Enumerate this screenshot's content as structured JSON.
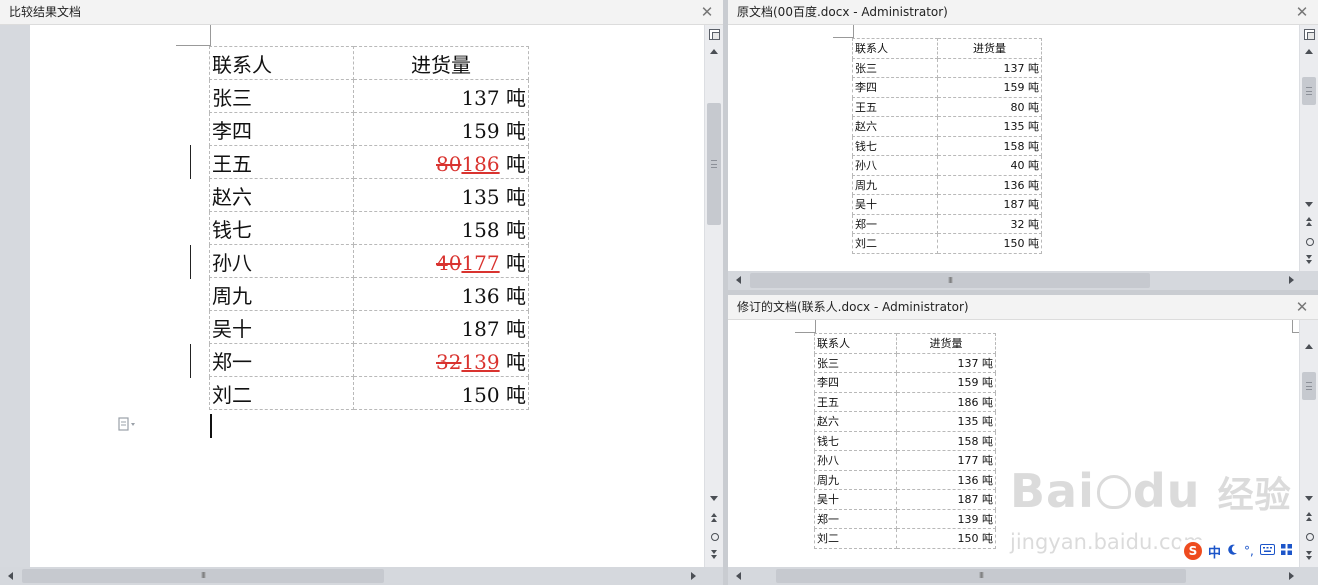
{
  "left_pane": {
    "title": "比较结果文档",
    "close": "✕",
    "header": [
      "联系人",
      "进货量"
    ],
    "unit": "吨",
    "rows": [
      {
        "name": "张三",
        "value": "137"
      },
      {
        "name": "李四",
        "value": "159"
      },
      {
        "name": "王五",
        "deleted": "80",
        "inserted": "186"
      },
      {
        "name": "赵六",
        "value": "135"
      },
      {
        "name": "钱七",
        "value": "158"
      },
      {
        "name": "孙八",
        "deleted": "40",
        "inserted": "177"
      },
      {
        "name": "周九",
        "value": "136"
      },
      {
        "name": "吴十",
        "value": "187"
      },
      {
        "name": "郑一",
        "deleted": "32",
        "inserted": "139"
      },
      {
        "name": "刘二",
        "value": "150"
      }
    ]
  },
  "original_pane": {
    "title": "原文档(00百度.docx - Administrator)",
    "close": "✕",
    "header": [
      "联系人",
      "进货量"
    ],
    "unit": "吨",
    "rows": [
      {
        "name": "张三",
        "value": "137"
      },
      {
        "name": "李四",
        "value": "159"
      },
      {
        "name": "王五",
        "value": "80"
      },
      {
        "name": "赵六",
        "value": "135"
      },
      {
        "name": "钱七",
        "value": "158"
      },
      {
        "name": "孙八",
        "value": "40"
      },
      {
        "name": "周九",
        "value": "136"
      },
      {
        "name": "吴十",
        "value": "187"
      },
      {
        "name": "郑一",
        "value": "32"
      },
      {
        "name": "刘二",
        "value": "150"
      }
    ]
  },
  "revised_pane": {
    "title": "修订的文档(联系人.docx - Administrator)",
    "close": "✕",
    "header": [
      "联系人",
      "进货量"
    ],
    "unit": "吨",
    "rows": [
      {
        "name": "张三",
        "value": "137"
      },
      {
        "name": "李四",
        "value": "159"
      },
      {
        "name": "王五",
        "value": "186"
      },
      {
        "name": "赵六",
        "value": "135"
      },
      {
        "name": "钱七",
        "value": "158"
      },
      {
        "name": "孙八",
        "value": "177"
      },
      {
        "name": "周九",
        "value": "136"
      },
      {
        "name": "吴十",
        "value": "187"
      },
      {
        "name": "郑一",
        "value": "139"
      },
      {
        "name": "刘二",
        "value": "150"
      }
    ]
  },
  "scrollbar": {
    "grip_h": "III"
  },
  "watermark": {
    "brand_a": "Bai",
    "brand_b": "du",
    "brand_cn": "经验",
    "url": "jingyan.baidu.com"
  },
  "ime": {
    "logo": "S",
    "lang": "中",
    "moon_icon": "moon-icon",
    "punct": "°,",
    "keyboard_icon": "keyboard-icon"
  },
  "colors": {
    "revision": "#d9332f",
    "ime_blue": "#1c55c9",
    "ime_logo": "#ee4b1e"
  }
}
